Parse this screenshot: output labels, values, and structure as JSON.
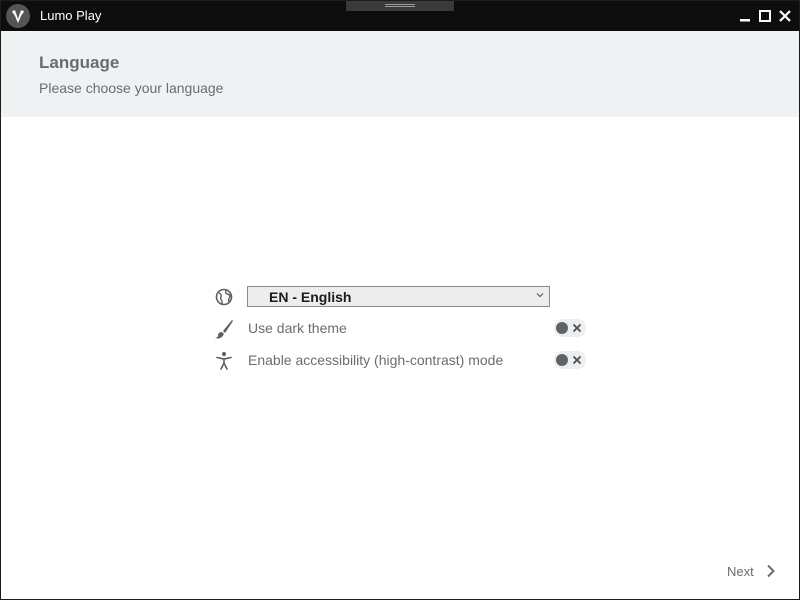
{
  "window": {
    "title": "Lumo Play",
    "logo_icon": "lumo-logo-icon",
    "controls": [
      "minimize-icon",
      "maximize-icon",
      "close-icon"
    ]
  },
  "header": {
    "title": "Language",
    "subtitle": "Please choose your language"
  },
  "settings": {
    "language": {
      "icon": "globe-icon",
      "selected": "EN - English"
    },
    "dark_theme": {
      "icon": "brush-icon",
      "label": "Use dark theme",
      "enabled": false
    },
    "accessibility": {
      "icon": "accessibility-icon",
      "label": "Enable accessibility (high-contrast) mode",
      "enabled": false
    }
  },
  "footer": {
    "next_label": "Next",
    "next_icon": "chevron-right-icon"
  },
  "colors": {
    "titlebar": "#0d0d0d",
    "header_bg": "#eef2f3",
    "text_muted": "#6a6d70",
    "toggle_knob": "#616467"
  }
}
